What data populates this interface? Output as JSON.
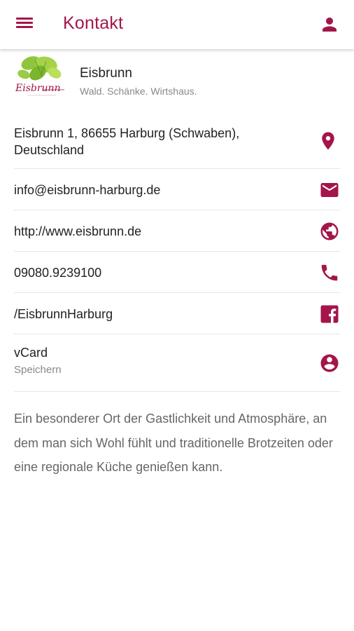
{
  "appbar": {
    "title": "Kontakt",
    "menu_icon": "menu-icon",
    "profile_icon": "person-icon",
    "accent_color": "#a3154b"
  },
  "organization": {
    "logo_text": "Eisbrunn",
    "name": "Eisbrunn",
    "tagline": "Wald. Schänke. Wirtshaus."
  },
  "contacts": {
    "address": {
      "line1": "Eisbrunn 1, 86655 Harburg (Schwaben),",
      "line2": "Deutschland",
      "icon": "location-pin-icon"
    },
    "email": {
      "text": "info@eisbrunn-harburg.de",
      "icon": "mail-icon"
    },
    "website": {
      "text": "http://www.eisbrunn.de",
      "icon": "globe-icon"
    },
    "phone": {
      "text": "09080.9239100",
      "icon": "phone-icon"
    },
    "facebook": {
      "text": "/EisbrunnHarburg",
      "icon": "facebook-icon"
    },
    "vcard": {
      "text": "vCard",
      "subtext": "Speichern",
      "icon": "account-circle-icon"
    }
  },
  "description": "Ein besonderer Ort der Gastlichkeit und Atmosphäre, an dem man sich Wohl fühlt und traditionelle Brotzeiten oder eine regionale Küche genießen kann."
}
